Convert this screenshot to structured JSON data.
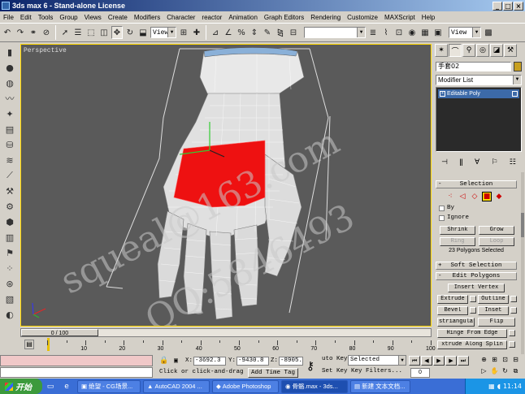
{
  "window": {
    "title": "3ds max 6 - Stand-alone License",
    "buttons": [
      "_",
      "□",
      "×"
    ]
  },
  "menu": [
    "File",
    "Edit",
    "Tools",
    "Group",
    "Views",
    "Create",
    "Modifiers",
    "Character",
    "reactor",
    "Animation",
    "Graph Editors",
    "Rendering",
    "Customize",
    "MAXScript",
    "Help"
  ],
  "toolbar": {
    "ref_coord": "View",
    "view_right": "View"
  },
  "viewport": {
    "label": "Perspective",
    "watermarks": [
      "squeal@163.com",
      "QQ:5846493"
    ]
  },
  "panel": {
    "object_name": "手套02",
    "modifier_list": "Modifier List",
    "stack_item": "Editable Poly",
    "rollouts": {
      "selection": "Selection",
      "soft_selection": "Soft Selection",
      "edit_polygons": "Edit Polygons"
    },
    "by_label": "By",
    "ignore_label": "Ignore",
    "shrink": "Shrink",
    "grow": "Grow",
    "ring": "Ring",
    "loop": "Loop",
    "selection_info": "23 Polygons Selected",
    "insert_vertex": "Insert Vertex",
    "extrude": "Extrude",
    "outline": "Outline",
    "bevel": "Bevel",
    "inset": "Inset",
    "retriangulate": "striangula",
    "flip": "Flip",
    "hinge_from_edge": "Hinge From Edge",
    "extrude_along_spline": "xtrude Along Splin"
  },
  "timeline": {
    "slider": "0 / 100",
    "ticks": [
      "10",
      "20",
      "30",
      "40",
      "50",
      "60",
      "70",
      "80",
      "90",
      "100"
    ]
  },
  "status": {
    "x": "-3692.3",
    "y": "-9430.8",
    "z": "-8905.",
    "prompt": "Click or click-and-drag",
    "add_time_tag": "Add Time Tag",
    "auto_key": "uto Key",
    "set_key": "Set Key",
    "selected": "Selected",
    "key_filters": "Key Filters...",
    "frame": "0"
  },
  "taskbar": {
    "start": "开始",
    "items": [
      "绝望 - CG场景...",
      "AutoCAD 2004 ...",
      "Adobe Photoshop",
      "骨骼.max - 3ds...",
      "新建 文本文档..."
    ],
    "time": "11:14"
  }
}
